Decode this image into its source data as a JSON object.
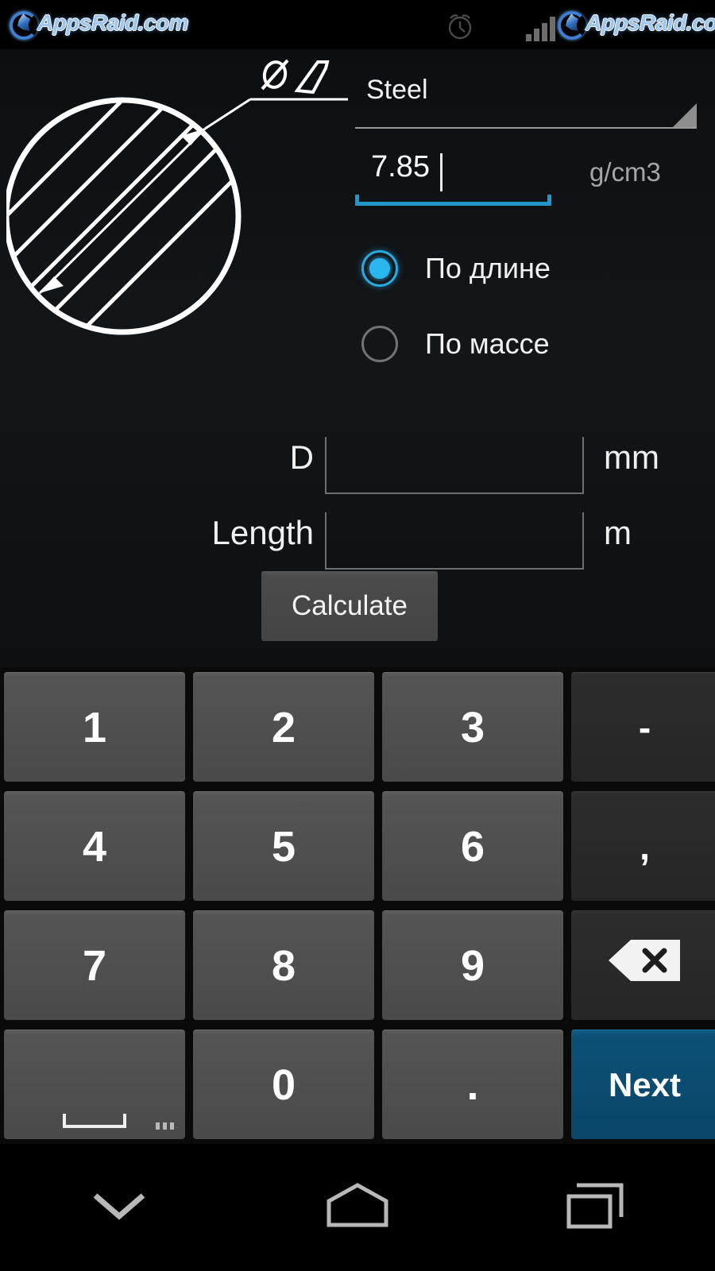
{
  "status_bar": {
    "watermark_left": "AppsRaid.com",
    "watermark_right": "AppsRaid.com",
    "alarm_icon": "alarm-clock-icon",
    "signal_icon": "signal-bars-icon"
  },
  "app": {
    "diagram": {
      "icon": "round-bar-cross-section-drawing",
      "dimension_label": "øD"
    },
    "material": {
      "selected": "Steel",
      "dropdown_icon": "spinner-caret-icon"
    },
    "density": {
      "value": "7.85",
      "unit": "g/cm3"
    },
    "mode_options": [
      {
        "label": "По длине",
        "selected": true
      },
      {
        "label": "По массе",
        "selected": false
      }
    ],
    "inputs": [
      {
        "label": "D",
        "value": "",
        "unit": "mm"
      },
      {
        "label": "Length",
        "value": "",
        "unit": "m"
      }
    ],
    "calculate_label": "Calculate"
  },
  "keyboard": {
    "rows": [
      [
        {
          "label": "1",
          "type": "num"
        },
        {
          "label": "2",
          "type": "num"
        },
        {
          "label": "3",
          "type": "num"
        },
        {
          "label": "-",
          "type": "fn"
        }
      ],
      [
        {
          "label": "4",
          "type": "num"
        },
        {
          "label": "5",
          "type": "num"
        },
        {
          "label": "6",
          "type": "num"
        },
        {
          "label": ",",
          "type": "fn"
        }
      ],
      [
        {
          "label": "7",
          "type": "num"
        },
        {
          "label": "8",
          "type": "num"
        },
        {
          "label": "9",
          "type": "num"
        },
        {
          "label": "",
          "type": "fn",
          "icon": "backspace-icon"
        }
      ],
      [
        {
          "label": "",
          "type": "space",
          "icon": "space-bar-icon"
        },
        {
          "label": "0",
          "type": "num"
        },
        {
          "label": ".",
          "type": "num"
        },
        {
          "label": "Next",
          "type": "action"
        }
      ]
    ]
  },
  "nav_bar": {
    "buttons": [
      {
        "icon": "chevron-down-icon"
      },
      {
        "icon": "home-icon"
      },
      {
        "icon": "recents-icon"
      }
    ]
  },
  "colors": {
    "accent": "#2ab6ef",
    "focused_underline": "#2196c9",
    "action_key": "#0c5177",
    "background": "#0e1114"
  }
}
